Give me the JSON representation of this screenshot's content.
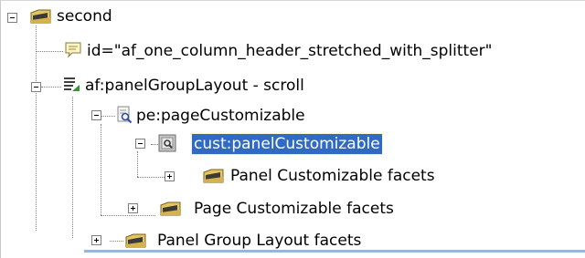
{
  "tree": {
    "nodes": [
      {
        "label": "second",
        "icon": "folder-icon",
        "toggle": "collapse"
      },
      {
        "label": "id=\"af_one_column_header_stretched_with_splitter\"",
        "icon": "comment-icon",
        "toggle": "none"
      },
      {
        "label": "af:panelGroupLayout - scroll",
        "icon": "panel-group-layout-icon",
        "toggle": "collapse"
      },
      {
        "label": "pe:pageCustomizable",
        "icon": "page-customizable-icon",
        "toggle": "collapse"
      },
      {
        "label": "cust:panelCustomizable",
        "icon": "panel-customizable-icon",
        "toggle": "collapse",
        "selected": true
      },
      {
        "label": "Panel Customizable facets",
        "icon": "folder-icon",
        "toggle": "expand"
      },
      {
        "label": "Page Customizable facets",
        "icon": "folder-icon",
        "toggle": "expand"
      },
      {
        "label": "Panel Group Layout facets",
        "icon": "folder-icon",
        "toggle": "expand"
      }
    ]
  },
  "colors": {
    "selection": "#316ac5",
    "folder": "#e3c561",
    "folder_tab": "#3a3a3a",
    "connector": "#808080"
  }
}
